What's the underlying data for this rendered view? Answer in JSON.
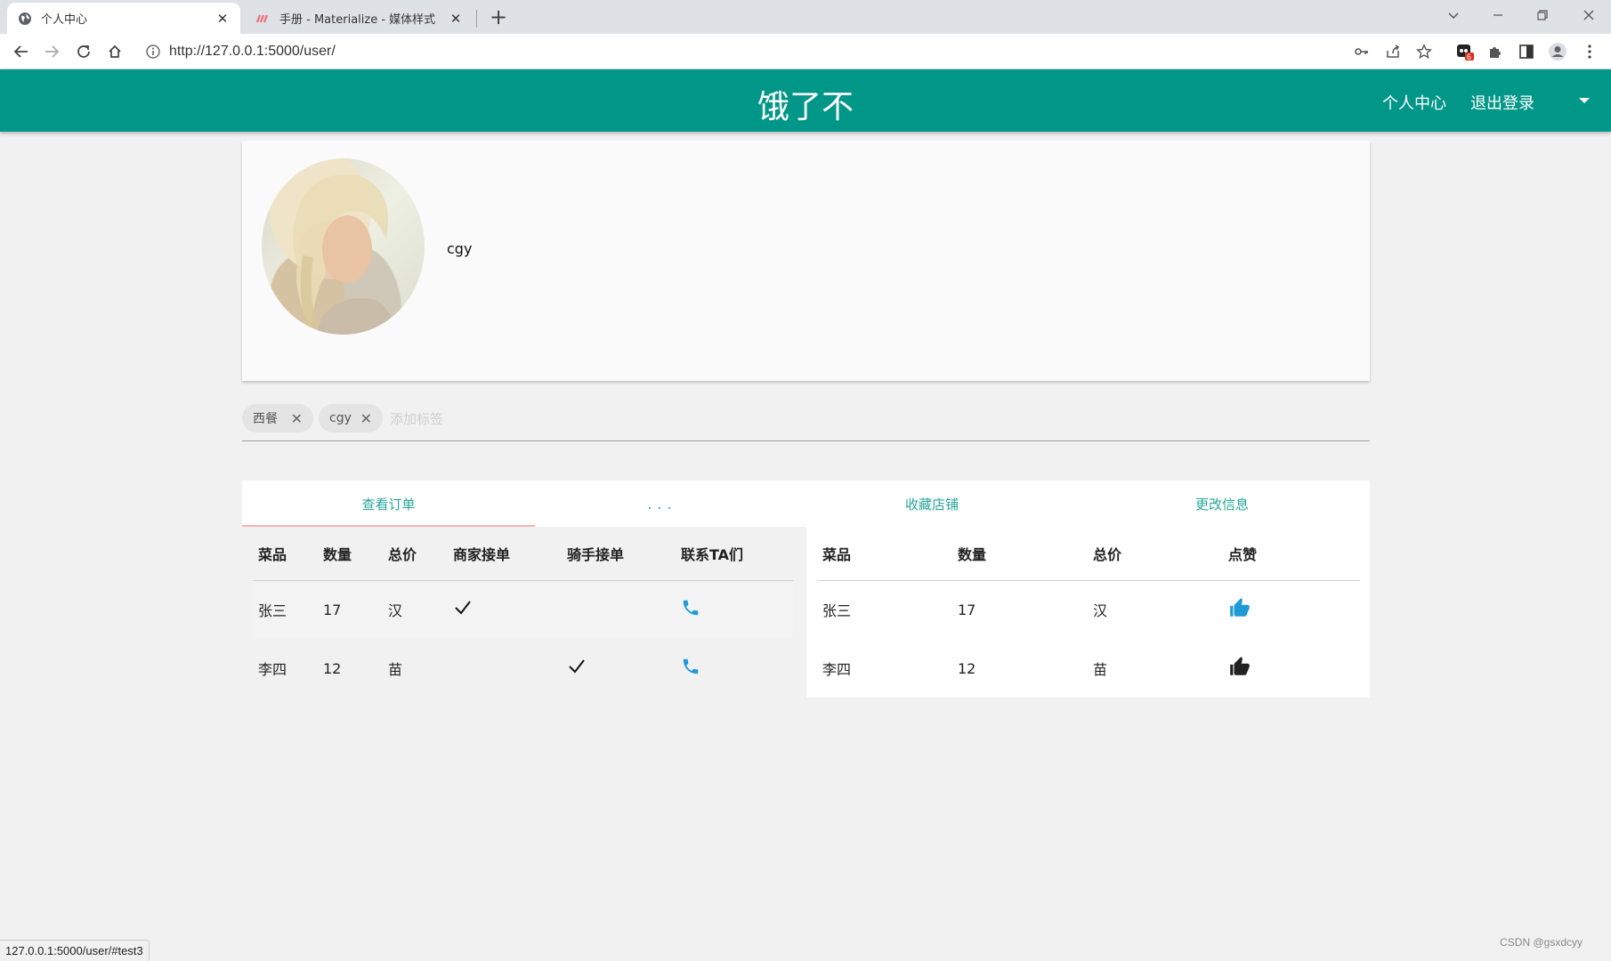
{
  "browser": {
    "tabs": [
      {
        "title": "个人中心",
        "active": true
      },
      {
        "title": "手册 - Materialize - 媒体样式",
        "active": false
      }
    ],
    "url": "http://127.0.0.1:5000/user/",
    "extension_badge": "6"
  },
  "nav": {
    "brand": "饿了不",
    "links": [
      "个人中心",
      "退出登录"
    ]
  },
  "profile": {
    "username": "cgy"
  },
  "chips": {
    "items": [
      "西餐",
      "cgy"
    ],
    "placeholder": "添加标签"
  },
  "tabs": {
    "orders": "查看订单",
    "dots": "...",
    "favorites": "收藏店铺",
    "edit": "更改信息"
  },
  "orders_table": {
    "headers": [
      "菜品",
      "数量",
      "总价",
      "商家接单",
      "骑手接单",
      "联系TA们"
    ],
    "rows": [
      {
        "dish": "张三",
        "qty": "17",
        "total": "汉",
        "merchant_accepted": true,
        "rider_accepted": false
      },
      {
        "dish": "李四",
        "qty": "12",
        "total": "苗",
        "merchant_accepted": false,
        "rider_accepted": true
      }
    ]
  },
  "fav_table": {
    "headers": [
      "菜品",
      "数量",
      "总价",
      "点赞"
    ],
    "rows": [
      {
        "dish": "张三",
        "qty": "17",
        "total": "汉",
        "liked_color": "#1e9bd7"
      },
      {
        "dish": "李四",
        "qty": "12",
        "total": "苗",
        "liked_color": "#222222"
      }
    ]
  },
  "status": {
    "link_preview": "127.0.0.1:5000/user/#test3",
    "watermark": "CSDN @gsxdcyy"
  },
  "colors": {
    "primary": "#009688",
    "tab_text": "#26a69a",
    "phone_icon": "#1e9bd7"
  }
}
